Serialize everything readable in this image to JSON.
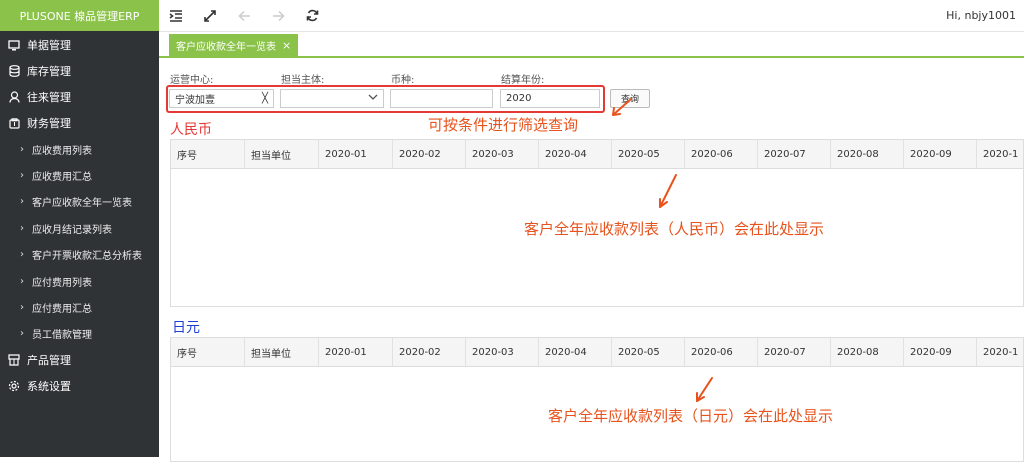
{
  "app": {
    "brand": "PLUSONE 楾品管理ERP",
    "greeting": "Hi, nbjy1001"
  },
  "sidebar": {
    "items": [
      {
        "label": "单据管理",
        "icon": "monitor-icon"
      },
      {
        "label": "库存管理",
        "icon": "database-icon"
      },
      {
        "label": "往来管理",
        "icon": "user-icon"
      },
      {
        "label": "财务管理",
        "icon": "wallet-icon"
      }
    ],
    "finance_sub": [
      "应收费用列表",
      "应收费用汇总",
      "客户应收款全年一览表",
      "应收月结记录列表",
      "客户开票收款汇总分析表",
      "应付费用列表",
      "应付费用汇总",
      "员工借款管理"
    ],
    "bottom": [
      {
        "label": "产品管理",
        "icon": "product-icon"
      },
      {
        "label": "系统设置",
        "icon": "gear-icon"
      }
    ]
  },
  "tab": {
    "label": "客户应收款全年一览表",
    "close": "×"
  },
  "filters": {
    "center_label": "运营中心:",
    "center_value": "宁波加壹",
    "clear": "╳",
    "subject_label": "担当主体:",
    "subject_value": "",
    "currency_label": "币种:",
    "currency_value": "",
    "year_label": "结算年份:",
    "year_value": "2020",
    "query_label": "查询"
  },
  "annotations": {
    "filter_hint": "可按条件进行筛选查询",
    "rmb_hint": "客户全年应收款列表（人民币）会在此处显示",
    "jpy_hint": "客户全年应收款列表（日元）会在此处显示"
  },
  "sections": {
    "rmb_title": "人民币",
    "jpy_title": "日元"
  },
  "table": {
    "columns": [
      "序号",
      "担当单位",
      "2020-01",
      "2020-02",
      "2020-03",
      "2020-04",
      "2020-05",
      "2020-06",
      "2020-07",
      "2020-08",
      "2020-09",
      "2020-1"
    ]
  },
  "colors": {
    "accent": "#8bc34a",
    "sidebar": "#2f3336",
    "annotation": "#e8521c",
    "red_title": "#e53935",
    "blue_title": "#1e3fd6"
  }
}
